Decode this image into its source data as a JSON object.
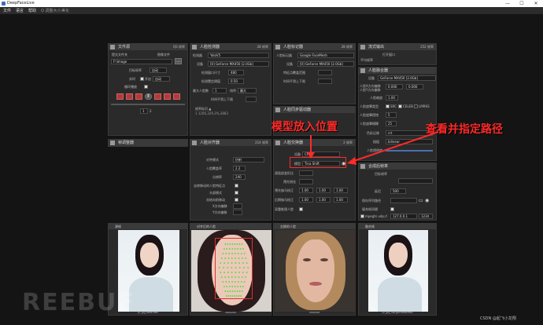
{
  "window": {
    "title": "DeepFaceLive",
    "minimize": "—",
    "maximize": "☐",
    "close": "✕"
  },
  "menu": {
    "items": [
      "文件",
      "语言",
      "帮助"
    ],
    "extra": "Q 调整大小",
    "extra2": "美化"
  },
  "file_source": {
    "title": "文件源",
    "fps": "QS 帧率",
    "opt_single": "提交文件夹",
    "opt_seq": "图像文件",
    "path": "F:\\Image",
    "target_fps_label": "目标帧率",
    "target_fps": "自动",
    "realtime_label": "实时",
    "realtime_check": "开启",
    "realtime_value": "自动",
    "loop_label": "循环播放",
    "page_value": "1",
    "page_total": "2"
  },
  "face_detector": {
    "title": "人脸检测器",
    "fps": "28 帧率",
    "detector_label": "检测器",
    "detector_value": "YoloV5",
    "device_label": "设备",
    "device_value": "[0] GeForce MX450 [2.0Gb]",
    "window_size_label": "检测窗口尺寸",
    "window_size_value": "480",
    "threshold_label": "检测置信阈值",
    "threshold_value": "0.50",
    "max_faces_label": "最大人脸数",
    "max_faces_value": "1",
    "sort_label": "排序",
    "sort_value": "最大",
    "temporal_label": "时间平滑上下限",
    "info_label": "帧率标识 ▲",
    "info_value": "1 1206,329,3%,3883"
  },
  "face_marker": {
    "title": "人脸标记器",
    "fps": "28 帧率",
    "type_label": "人脸标记器",
    "type_value": "Google FaceMesh",
    "device_label": "设备",
    "device_value": "[0] GeForce MX450 [2.0Gb]",
    "coverage_label": "特征点覆盖范围",
    "smooth_label": "时间平滑上下限"
  },
  "face_animator": {
    "title": "人脸同步驱动器"
  },
  "face_aligner": {
    "title": "人脸对齐器",
    "fps": "214 帧率",
    "mode_label": "对齐模式",
    "mode_value": "仿射",
    "coverage_label": "人脸覆盖率",
    "coverage_value": "2.2",
    "resolution_label": "分辨率",
    "resolution_value": "240",
    "exclude_label": "去除移动的人脸特征点",
    "head_label": "头部模式",
    "freeze_label": "冻结向前移动",
    "x_label": "X方向偏移",
    "y_label": "Y方向偏移"
  },
  "face_swapper": {
    "title": "人脸交换器",
    "fps": "2 帧率",
    "device_label": "设备",
    "device_value": "CPU",
    "model_label": "模型",
    "model_value": "Tina Shift",
    "morph_label": "源面部变形比",
    "pre_sharpen_label": "预先锐化",
    "pre_gamma_label": "预先伽马校正",
    "gamma_r": "1.00",
    "gamma_g": "1.00",
    "gamma_b": "1.00",
    "post_gamma_label": "后期伽马校正",
    "post_r": "1.00",
    "post_g": "1.00",
    "post_b": "1.00",
    "two_pass_label": "双重推理人脸"
  },
  "frame_adjust": {
    "title": "帧调整器"
  },
  "face_merger": {
    "title": "人脸融合器",
    "device_label": "设备",
    "device_value": "GeForce MX450 [2.0Gb]",
    "offset_label": "人脸X方向偏移",
    "offset_y_label": "人脸Y方向偏移",
    "offset_x": "0.000",
    "offset_y": "0.000",
    "scale_label": "人脸缩放",
    "scale_value": "1.00",
    "mask_label": "人脸遮罩类型",
    "mask_src": "SRC",
    "mask_celeb": "CELEB",
    "mask_lmrks": "LMRKS",
    "erode_label": "人脸遮罩侵蚀",
    "erode_value": "5",
    "blur_label": "人脸遮罩模糊",
    "blur_value": "25",
    "color_label": "色彩迁移",
    "color_value": "rct",
    "interp_label": "插值",
    "interp_value": "bilinear",
    "opacity_label": "人脸透明度"
  },
  "stream_output": {
    "title": "流式输出",
    "fps": "252 帧率",
    "window_label": "打开窗口",
    "source_label": "平均帧率",
    "target_label": "目标帧率",
    "delay_label": "延迟",
    "queue_label": "合成后帧率",
    "save_label": "保存序列路径",
    "save_path": "",
    "fill_label": "填充帧间隔",
    "stream_label": "mpegts udp://",
    "stream_value": "127.0.0.1",
    "port_value": "1234",
    "delay_value": "500",
    "check_value": "1"
  },
  "annotations": {
    "model": "模型放入位置",
    "path": "查看并指定路径"
  },
  "views": {
    "v1": {
      "title": "源帧",
      "caption": "yn_jpg_00017997"
    },
    "v2": {
      "title": "对齐后的人脸",
      "caption": "240x240"
    },
    "v3": {
      "title": "交换的人脸",
      "caption": "240x240"
    },
    "v4": {
      "title": "融合帧",
      "caption": "yn_jpg_merged 00067814"
    }
  },
  "watermark": {
    "main": "REEBUF",
    "credit": "CSDN @起飞小龙翔"
  },
  "colors": {
    "bg": "#141414",
    "panel": "#2a2a2a",
    "accent_red": "#ff2a2a",
    "landmark": "#35e035"
  }
}
